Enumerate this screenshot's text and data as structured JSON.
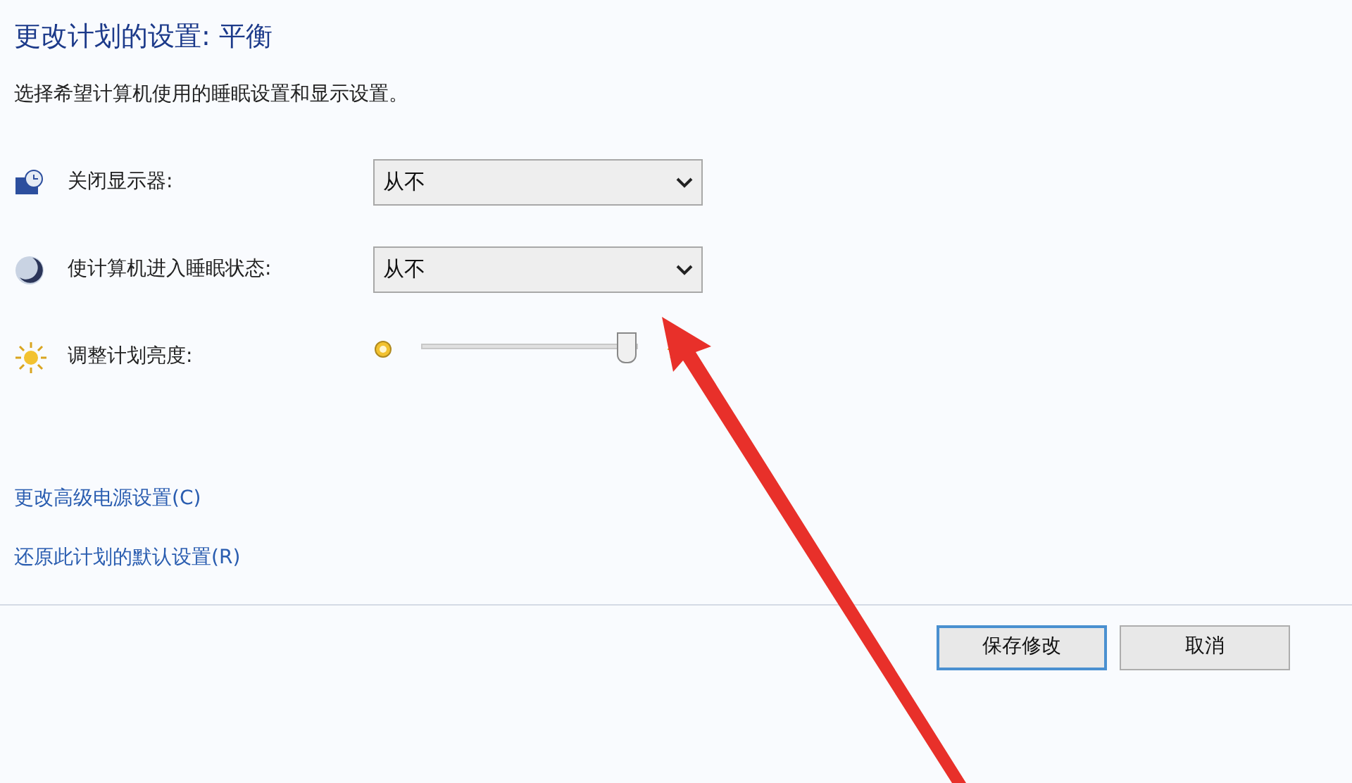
{
  "title": "更改计划的设置: 平衡",
  "subtitle": "选择希望计算机使用的睡眠设置和显示设置。",
  "settings": [
    {
      "kind": "dropdown",
      "label": "关闭显示器:",
      "value": "从不"
    },
    {
      "kind": "dropdown",
      "label": "使计算机进入睡眠状态:",
      "value": "从不"
    },
    {
      "kind": "slider",
      "label": "调整计划亮度:",
      "level": 0.95
    }
  ],
  "links": [
    "更改高级电源设置(C)",
    "还原此计划的默认设置(R)"
  ],
  "buttons": [
    {
      "label": "保存修改",
      "default": true
    },
    {
      "label": "取消",
      "default": false
    }
  ]
}
